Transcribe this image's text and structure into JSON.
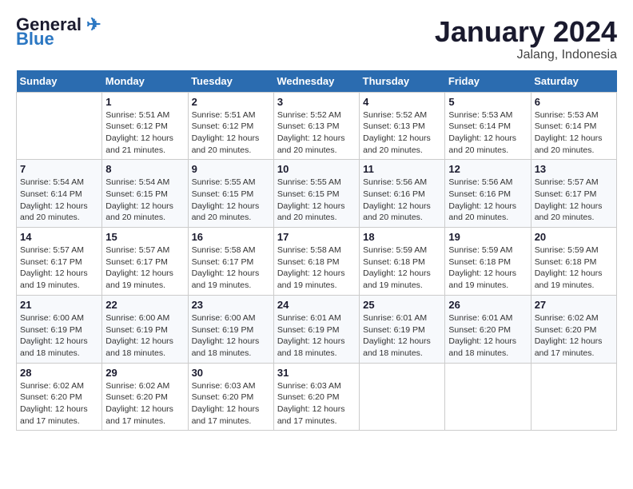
{
  "header": {
    "logo_line1": "General",
    "logo_line2": "Blue",
    "month": "January 2024",
    "location": "Jalang, Indonesia"
  },
  "weekdays": [
    "Sunday",
    "Monday",
    "Tuesday",
    "Wednesday",
    "Thursday",
    "Friday",
    "Saturday"
  ],
  "weeks": [
    [
      {
        "day": "",
        "info": ""
      },
      {
        "day": "1",
        "info": "Sunrise: 5:51 AM\nSunset: 6:12 PM\nDaylight: 12 hours\nand 21 minutes."
      },
      {
        "day": "2",
        "info": "Sunrise: 5:51 AM\nSunset: 6:12 PM\nDaylight: 12 hours\nand 20 minutes."
      },
      {
        "day": "3",
        "info": "Sunrise: 5:52 AM\nSunset: 6:13 PM\nDaylight: 12 hours\nand 20 minutes."
      },
      {
        "day": "4",
        "info": "Sunrise: 5:52 AM\nSunset: 6:13 PM\nDaylight: 12 hours\nand 20 minutes."
      },
      {
        "day": "5",
        "info": "Sunrise: 5:53 AM\nSunset: 6:14 PM\nDaylight: 12 hours\nand 20 minutes."
      },
      {
        "day": "6",
        "info": "Sunrise: 5:53 AM\nSunset: 6:14 PM\nDaylight: 12 hours\nand 20 minutes."
      }
    ],
    [
      {
        "day": "7",
        "info": ""
      },
      {
        "day": "8",
        "info": "Sunrise: 5:54 AM\nSunset: 6:15 PM\nDaylight: 12 hours\nand 20 minutes."
      },
      {
        "day": "9",
        "info": "Sunrise: 5:55 AM\nSunset: 6:15 PM\nDaylight: 12 hours\nand 20 minutes."
      },
      {
        "day": "10",
        "info": "Sunrise: 5:55 AM\nSunset: 6:15 PM\nDaylight: 12 hours\nand 20 minutes."
      },
      {
        "day": "11",
        "info": "Sunrise: 5:56 AM\nSunset: 6:16 PM\nDaylight: 12 hours\nand 20 minutes."
      },
      {
        "day": "12",
        "info": "Sunrise: 5:56 AM\nSunset: 6:16 PM\nDaylight: 12 hours\nand 20 minutes."
      },
      {
        "day": "13",
        "info": "Sunrise: 5:57 AM\nSunset: 6:17 PM\nDaylight: 12 hours\nand 20 minutes."
      }
    ],
    [
      {
        "day": "14",
        "info": ""
      },
      {
        "day": "15",
        "info": "Sunrise: 5:57 AM\nSunset: 6:17 PM\nDaylight: 12 hours\nand 19 minutes."
      },
      {
        "day": "16",
        "info": "Sunrise: 5:58 AM\nSunset: 6:17 PM\nDaylight: 12 hours\nand 19 minutes."
      },
      {
        "day": "17",
        "info": "Sunrise: 5:58 AM\nSunset: 6:18 PM\nDaylight: 12 hours\nand 19 minutes."
      },
      {
        "day": "18",
        "info": "Sunrise: 5:59 AM\nSunset: 6:18 PM\nDaylight: 12 hours\nand 19 minutes."
      },
      {
        "day": "19",
        "info": "Sunrise: 5:59 AM\nSunset: 6:18 PM\nDaylight: 12 hours\nand 19 minutes."
      },
      {
        "day": "20",
        "info": "Sunrise: 5:59 AM\nSunset: 6:18 PM\nDaylight: 12 hours\nand 19 minutes."
      }
    ],
    [
      {
        "day": "21",
        "info": ""
      },
      {
        "day": "22",
        "info": "Sunrise: 6:00 AM\nSunset: 6:19 PM\nDaylight: 12 hours\nand 18 minutes."
      },
      {
        "day": "23",
        "info": "Sunrise: 6:00 AM\nSunset: 6:19 PM\nDaylight: 12 hours\nand 18 minutes."
      },
      {
        "day": "24",
        "info": "Sunrise: 6:01 AM\nSunset: 6:19 PM\nDaylight: 12 hours\nand 18 minutes."
      },
      {
        "day": "25",
        "info": "Sunrise: 6:01 AM\nSunset: 6:19 PM\nDaylight: 12 hours\nand 18 minutes."
      },
      {
        "day": "26",
        "info": "Sunrise: 6:01 AM\nSunset: 6:20 PM\nDaylight: 12 hours\nand 18 minutes."
      },
      {
        "day": "27",
        "info": "Sunrise: 6:02 AM\nSunset: 6:20 PM\nDaylight: 12 hours\nand 17 minutes."
      }
    ],
    [
      {
        "day": "28",
        "info": "Sunrise: 6:02 AM\nSunset: 6:20 PM\nDaylight: 12 hours\nand 17 minutes."
      },
      {
        "day": "29",
        "info": "Sunrise: 6:02 AM\nSunset: 6:20 PM\nDaylight: 12 hours\nand 17 minutes."
      },
      {
        "day": "30",
        "info": "Sunrise: 6:03 AM\nSunset: 6:20 PM\nDaylight: 12 hours\nand 17 minutes."
      },
      {
        "day": "31",
        "info": "Sunrise: 6:03 AM\nSunset: 6:20 PM\nDaylight: 12 hours\nand 17 minutes."
      },
      {
        "day": "",
        "info": ""
      },
      {
        "day": "",
        "info": ""
      },
      {
        "day": "",
        "info": ""
      }
    ]
  ],
  "week7_sunday_info": "Sunrise: 5:54 AM\nSunset: 6:14 PM\nDaylight: 12 hours\nand 20 minutes.",
  "week14_sunday_info": "Sunrise: 5:57 AM\nSunset: 6:17 PM\nDaylight: 12 hours\nand 19 minutes.",
  "week21_sunday_info": "Sunrise: 6:00 AM\nSunset: 6:19 PM\nDaylight: 12 hours\nand 18 minutes."
}
